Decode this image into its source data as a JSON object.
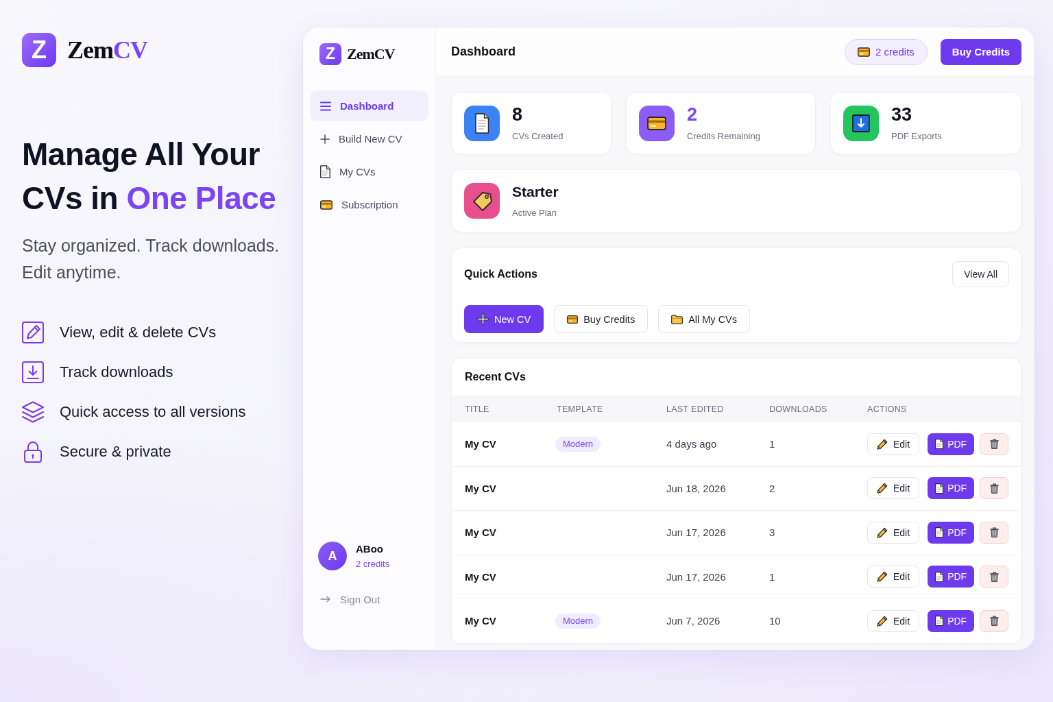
{
  "brand": {
    "mark": "Z",
    "name": "Zem",
    "name_accent": "CV"
  },
  "hero": {
    "headline": "Manage All Your CVs in",
    "headline_accent": "One Place",
    "subtitle": "Stay organized. Track downloads. Edit anytime."
  },
  "features": [
    {
      "kind": "edit",
      "label": "View, edit & delete CVs"
    },
    {
      "kind": "download",
      "label": "Track downloads"
    },
    {
      "kind": "layers",
      "label": "Quick access to all versions"
    },
    {
      "kind": "lock",
      "label": "Secure & private"
    }
  ],
  "sidebar": {
    "brand": {
      "mark": "Z",
      "name": "ZemCV"
    },
    "nav": [
      {
        "kind": "menu",
        "label": "Dashboard",
        "selected": true
      },
      {
        "kind": "plus",
        "label": "Build New CV",
        "selected": false
      },
      {
        "kind": "document",
        "label": "My CVs",
        "selected": false
      },
      {
        "kind": "card",
        "label": "Subscription",
        "selected": false
      }
    ],
    "user": {
      "initial": "A",
      "name": "ABoo",
      "credits": "2 credits"
    },
    "sign_out": "Sign Out"
  },
  "header": {
    "title": "Dashboard",
    "credits": "2 credits",
    "buy_button": "Buy Credits"
  },
  "stats": [
    {
      "kind": "document",
      "value": "8",
      "label": "CVs Created",
      "color": "#3b82f6",
      "accent": false
    },
    {
      "kind": "card",
      "value": "2",
      "label": "Credits Remaining",
      "color": "#8b5cf6",
      "accent": true
    },
    {
      "kind": "download",
      "value": "33",
      "label": "PDF Exports",
      "color": "#22c55e",
      "accent": false
    }
  ],
  "plan": {
    "name": "Starter",
    "label": "Active Plan"
  },
  "quick_actions": {
    "title": "Quick Actions",
    "view_all": "View All",
    "buttons": [
      {
        "kind": "plus",
        "label": "New CV",
        "primary": true
      },
      {
        "kind": "card",
        "label": "Buy Credits",
        "primary": false
      },
      {
        "kind": "folder",
        "label": "All My CVs",
        "primary": false
      }
    ]
  },
  "recent_cvs": {
    "title": "Recent CVs",
    "columns": [
      "TITLE",
      "TEMPLATE",
      "LAST EDITED",
      "DOWNLOADS",
      "ACTIONS"
    ],
    "rows": [
      {
        "title": "My CV",
        "template": "Modern",
        "last_edited": "4 days ago",
        "downloads": "1",
        "edit": "Edit",
        "pdf": "PDF"
      },
      {
        "title": "My CV",
        "last_edited": "Jun 18, 2026",
        "downloads": "2",
        "edit": "Edit",
        "pdf": "PDF"
      },
      {
        "title": "My CV",
        "last_edited": "Jun 17, 2026",
        "downloads": "3",
        "edit": "Edit",
        "pdf": "PDF"
      },
      {
        "title": "My CV",
        "last_edited": "Jun 17, 2026",
        "downloads": "1",
        "edit": "Edit",
        "pdf": "PDF"
      },
      {
        "title": "My CV",
        "template": "Modern",
        "last_edited": "Jun 7, 2026",
        "downloads": "10",
        "edit": "Edit",
        "pdf": "PDF"
      }
    ]
  }
}
